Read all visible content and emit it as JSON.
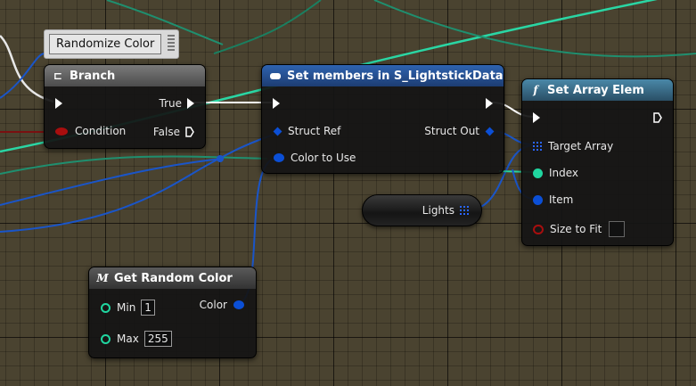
{
  "comment": {
    "label": "Randomize Color"
  },
  "branch": {
    "title": "Branch",
    "exec_in_label": "",
    "true_label": "True",
    "false_label": "False",
    "condition_label": "Condition",
    "header_color": "#6b6b6b"
  },
  "set_members": {
    "title": "Set members in S_LightstickData",
    "struct_ref_label": "Struct Ref",
    "struct_out_label": "Struct Out",
    "color_label": "Color to Use",
    "header_color": "#2b5a9e"
  },
  "set_array": {
    "title": "Set Array Elem",
    "target_label": "Target Array",
    "index_label": "Index",
    "item_label": "Item",
    "size_label": "Size to Fit",
    "header_color": "#3b6b86"
  },
  "lights": {
    "label": "Lights"
  },
  "get_random": {
    "title": "Get Random Color",
    "min_label": "Min",
    "min_value": "1",
    "max_label": "Max",
    "max_value": "255",
    "color_label": "Color",
    "header_color": "#4a4a4a"
  },
  "colors": {
    "exec": "#ffffff",
    "bool_pin": "#a80e0e",
    "struct_pin": "#0b4fd6",
    "int_pin": "#20d6a0",
    "wire_teal": "#2ad6a4",
    "wire_blue": "#1a55c8"
  }
}
